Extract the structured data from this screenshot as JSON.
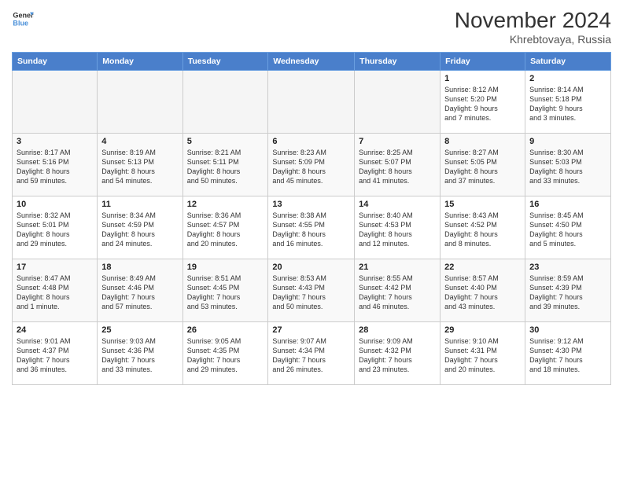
{
  "header": {
    "logo_line1": "General",
    "logo_line2": "Blue",
    "month_title": "November 2024",
    "location": "Khrebtovaya, Russia"
  },
  "weekdays": [
    "Sunday",
    "Monday",
    "Tuesday",
    "Wednesday",
    "Thursday",
    "Friday",
    "Saturday"
  ],
  "weeks": [
    [
      {
        "day": "",
        "info": ""
      },
      {
        "day": "",
        "info": ""
      },
      {
        "day": "",
        "info": ""
      },
      {
        "day": "",
        "info": ""
      },
      {
        "day": "",
        "info": ""
      },
      {
        "day": "1",
        "info": "Sunrise: 8:12 AM\nSunset: 5:20 PM\nDaylight: 9 hours\nand 7 minutes."
      },
      {
        "day": "2",
        "info": "Sunrise: 8:14 AM\nSunset: 5:18 PM\nDaylight: 9 hours\nand 3 minutes."
      }
    ],
    [
      {
        "day": "3",
        "info": "Sunrise: 8:17 AM\nSunset: 5:16 PM\nDaylight: 8 hours\nand 59 minutes."
      },
      {
        "day": "4",
        "info": "Sunrise: 8:19 AM\nSunset: 5:13 PM\nDaylight: 8 hours\nand 54 minutes."
      },
      {
        "day": "5",
        "info": "Sunrise: 8:21 AM\nSunset: 5:11 PM\nDaylight: 8 hours\nand 50 minutes."
      },
      {
        "day": "6",
        "info": "Sunrise: 8:23 AM\nSunset: 5:09 PM\nDaylight: 8 hours\nand 45 minutes."
      },
      {
        "day": "7",
        "info": "Sunrise: 8:25 AM\nSunset: 5:07 PM\nDaylight: 8 hours\nand 41 minutes."
      },
      {
        "day": "8",
        "info": "Sunrise: 8:27 AM\nSunset: 5:05 PM\nDaylight: 8 hours\nand 37 minutes."
      },
      {
        "day": "9",
        "info": "Sunrise: 8:30 AM\nSunset: 5:03 PM\nDaylight: 8 hours\nand 33 minutes."
      }
    ],
    [
      {
        "day": "10",
        "info": "Sunrise: 8:32 AM\nSunset: 5:01 PM\nDaylight: 8 hours\nand 29 minutes."
      },
      {
        "day": "11",
        "info": "Sunrise: 8:34 AM\nSunset: 4:59 PM\nDaylight: 8 hours\nand 24 minutes."
      },
      {
        "day": "12",
        "info": "Sunrise: 8:36 AM\nSunset: 4:57 PM\nDaylight: 8 hours\nand 20 minutes."
      },
      {
        "day": "13",
        "info": "Sunrise: 8:38 AM\nSunset: 4:55 PM\nDaylight: 8 hours\nand 16 minutes."
      },
      {
        "day": "14",
        "info": "Sunrise: 8:40 AM\nSunset: 4:53 PM\nDaylight: 8 hours\nand 12 minutes."
      },
      {
        "day": "15",
        "info": "Sunrise: 8:43 AM\nSunset: 4:52 PM\nDaylight: 8 hours\nand 8 minutes."
      },
      {
        "day": "16",
        "info": "Sunrise: 8:45 AM\nSunset: 4:50 PM\nDaylight: 8 hours\nand 5 minutes."
      }
    ],
    [
      {
        "day": "17",
        "info": "Sunrise: 8:47 AM\nSunset: 4:48 PM\nDaylight: 8 hours\nand 1 minute."
      },
      {
        "day": "18",
        "info": "Sunrise: 8:49 AM\nSunset: 4:46 PM\nDaylight: 7 hours\nand 57 minutes."
      },
      {
        "day": "19",
        "info": "Sunrise: 8:51 AM\nSunset: 4:45 PM\nDaylight: 7 hours\nand 53 minutes."
      },
      {
        "day": "20",
        "info": "Sunrise: 8:53 AM\nSunset: 4:43 PM\nDaylight: 7 hours\nand 50 minutes."
      },
      {
        "day": "21",
        "info": "Sunrise: 8:55 AM\nSunset: 4:42 PM\nDaylight: 7 hours\nand 46 minutes."
      },
      {
        "day": "22",
        "info": "Sunrise: 8:57 AM\nSunset: 4:40 PM\nDaylight: 7 hours\nand 43 minutes."
      },
      {
        "day": "23",
        "info": "Sunrise: 8:59 AM\nSunset: 4:39 PM\nDaylight: 7 hours\nand 39 minutes."
      }
    ],
    [
      {
        "day": "24",
        "info": "Sunrise: 9:01 AM\nSunset: 4:37 PM\nDaylight: 7 hours\nand 36 minutes."
      },
      {
        "day": "25",
        "info": "Sunrise: 9:03 AM\nSunset: 4:36 PM\nDaylight: 7 hours\nand 33 minutes."
      },
      {
        "day": "26",
        "info": "Sunrise: 9:05 AM\nSunset: 4:35 PM\nDaylight: 7 hours\nand 29 minutes."
      },
      {
        "day": "27",
        "info": "Sunrise: 9:07 AM\nSunset: 4:34 PM\nDaylight: 7 hours\nand 26 minutes."
      },
      {
        "day": "28",
        "info": "Sunrise: 9:09 AM\nSunset: 4:32 PM\nDaylight: 7 hours\nand 23 minutes."
      },
      {
        "day": "29",
        "info": "Sunrise: 9:10 AM\nSunset: 4:31 PM\nDaylight: 7 hours\nand 20 minutes."
      },
      {
        "day": "30",
        "info": "Sunrise: 9:12 AM\nSunset: 4:30 PM\nDaylight: 7 hours\nand 18 minutes."
      }
    ]
  ]
}
